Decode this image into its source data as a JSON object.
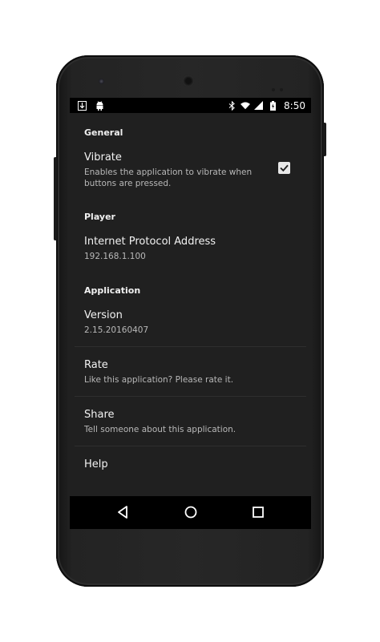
{
  "statusbar": {
    "left_icons": [
      "download-icon",
      "android-icon"
    ],
    "right_icons": [
      "bluetooth-icon",
      "wifi-icon",
      "signal-icon",
      "battery-icon"
    ],
    "time": "8:50"
  },
  "settings": {
    "sections": [
      {
        "header": "General",
        "items": [
          {
            "title": "Vibrate",
            "summary": "Enables the application to vibrate when buttons are pressed.",
            "checkbox_checked": true
          }
        ]
      },
      {
        "header": "Player",
        "items": [
          {
            "title": "Internet Protocol Address",
            "summary": "192.168.1.100"
          }
        ]
      },
      {
        "header": "Application",
        "items": [
          {
            "title": "Version",
            "summary": "2.15.20160407"
          },
          {
            "title": "Rate",
            "summary": "Like this application? Please rate it."
          },
          {
            "title": "Share",
            "summary": "Tell someone about this application."
          },
          {
            "title": "Help",
            "summary": ""
          }
        ]
      }
    ]
  },
  "navbar": {
    "buttons": [
      "back-icon",
      "home-icon",
      "recents-icon"
    ]
  },
  "colors": {
    "background": "#202020",
    "statusbar": "#000000",
    "text_primary": "#f2f2f2",
    "text_secondary": "#b8b8b8",
    "checkbox": "#e8e8e8"
  }
}
